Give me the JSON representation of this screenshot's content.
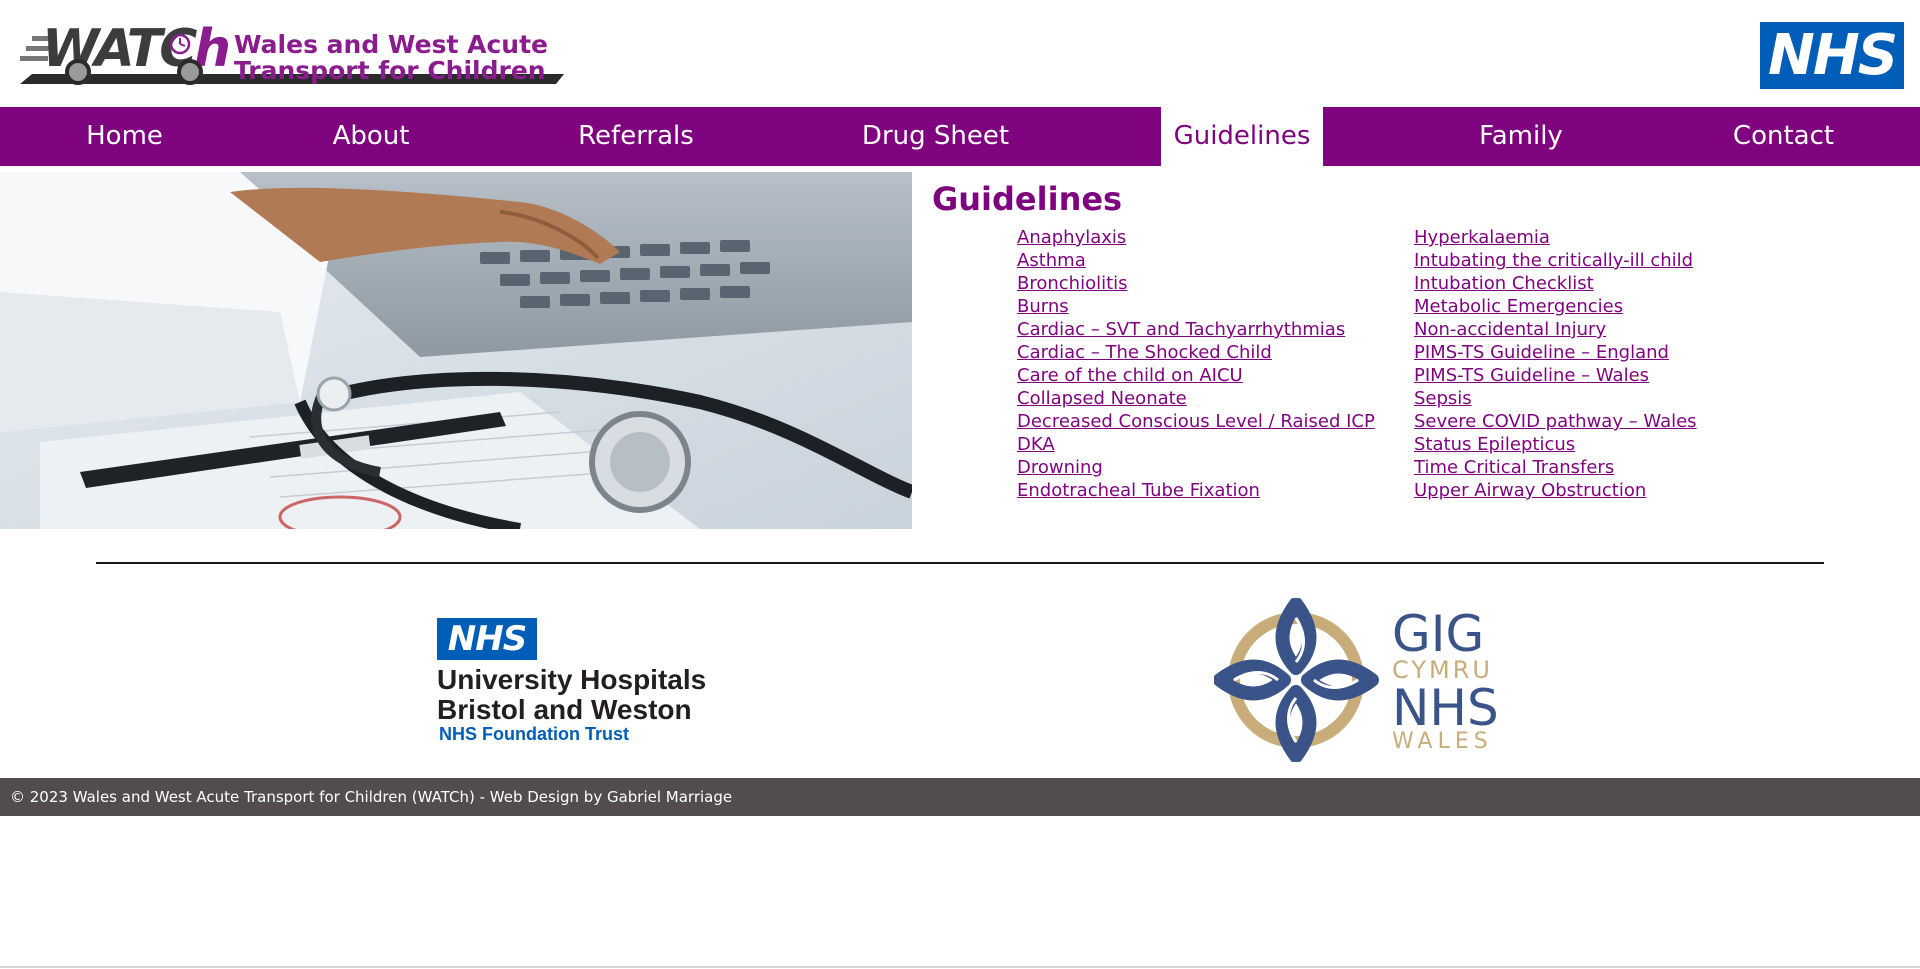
{
  "header": {
    "logo_wordmark": "WATCh",
    "logo_line1": "Wales and West Acute",
    "logo_line2": "Transport for Children",
    "nhs_logo_text": "NHS"
  },
  "nav": {
    "items": [
      {
        "label": "Home",
        "active": false
      },
      {
        "label": "About",
        "active": false
      },
      {
        "label": "Referrals",
        "active": false
      },
      {
        "label": "Drug Sheet",
        "active": false
      },
      {
        "label": "Guidelines",
        "active": true
      },
      {
        "label": "Family",
        "active": false
      },
      {
        "label": "Contact",
        "active": false
      }
    ]
  },
  "content": {
    "title": "Guidelines",
    "left_column": [
      "Anaphylaxis",
      "Asthma",
      "Bronchiolitis",
      "Burns",
      "Cardiac – SVT and Tachyarrhythmias",
      "Cardiac – The Shocked Child",
      "Care of the child on AICU",
      "Collapsed Neonate",
      "Decreased Conscious Level / Raised ICP",
      "DKA",
      "Drowning",
      "Endotracheal Tube Fixation"
    ],
    "right_column": [
      "Hyperkalaemia",
      "Intubating the critically-ill child",
      "Intubation Checklist",
      "Metabolic Emergencies",
      "Non-accidental Injury",
      "PIMS-TS Guideline – England",
      "PIMS-TS Guideline – Wales",
      "Sepsis",
      "Severe COVID pathway – Wales",
      "Status Epilepticus",
      "Time Critical Transfers",
      "Upper Airway Obstruction"
    ]
  },
  "partners": {
    "uhb": {
      "nhs": "NHS",
      "line1": "University Hospitals",
      "line2": "Bristol and Weston",
      "line3": "NHS Foundation Trust"
    },
    "gig": {
      "line1": "GIG",
      "line2": "CYMRU",
      "line3": "NHS",
      "line4": "WALES"
    }
  },
  "footer": {
    "text": "© 2023 Wales and West Acute Transport for Children (WATCh) - Web Design by Gabriel Marriage"
  },
  "colors": {
    "brand_purple": "#7f027f",
    "nhs_blue": "#005eb8",
    "footer_bg": "#524c4c",
    "gig_blue": "#3a5389",
    "gig_gold": "#c8ad7a"
  }
}
